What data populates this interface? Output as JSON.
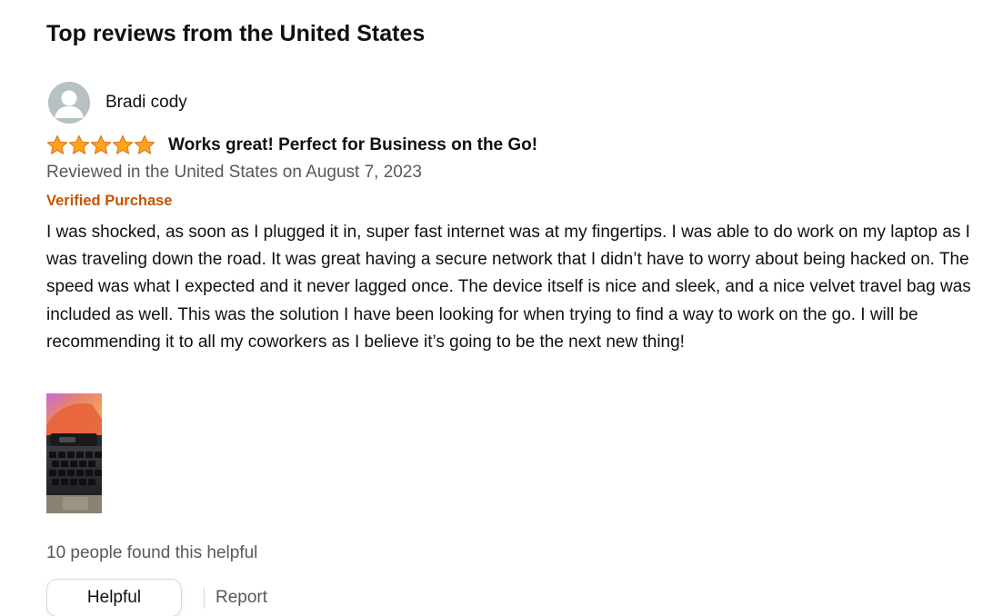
{
  "section": {
    "title": "Top reviews from the United States"
  },
  "review": {
    "author": "Bradi cody",
    "rating": 5,
    "rating_max": 5,
    "title": "Works great! Perfect for Business on the Go!",
    "date_line": "Reviewed in the United States on August 7, 2023",
    "verified_label": "Verified Purchase",
    "body": "I was shocked, as soon as I plugged it in, super fast internet was at my fingertips. I was able to do work on my laptop as I was traveling down the road. It was great having a secure network that I didn’t have to worry about being hacked on. The speed was what I expected and it never lagged once. The device itself is nice and sleek, and a nice velvet travel bag was included as well. This was the solution I have been looking for when trying to find a way to work on the go. I will be recommending it to all my coworkers as I believe it’s going to be the next new thing!",
    "helpful_count_text": "10 people found this helpful",
    "helpful_button_label": "Helpful",
    "report_label": "Report"
  },
  "icons": {
    "avatar": "default-avatar-icon",
    "star": "star-icon"
  },
  "colors": {
    "star_fill": "#ffa41c",
    "star_stroke": "#de7921",
    "verified": "#c45500",
    "secondary_text": "#565959",
    "primary_text": "#0f1111"
  }
}
